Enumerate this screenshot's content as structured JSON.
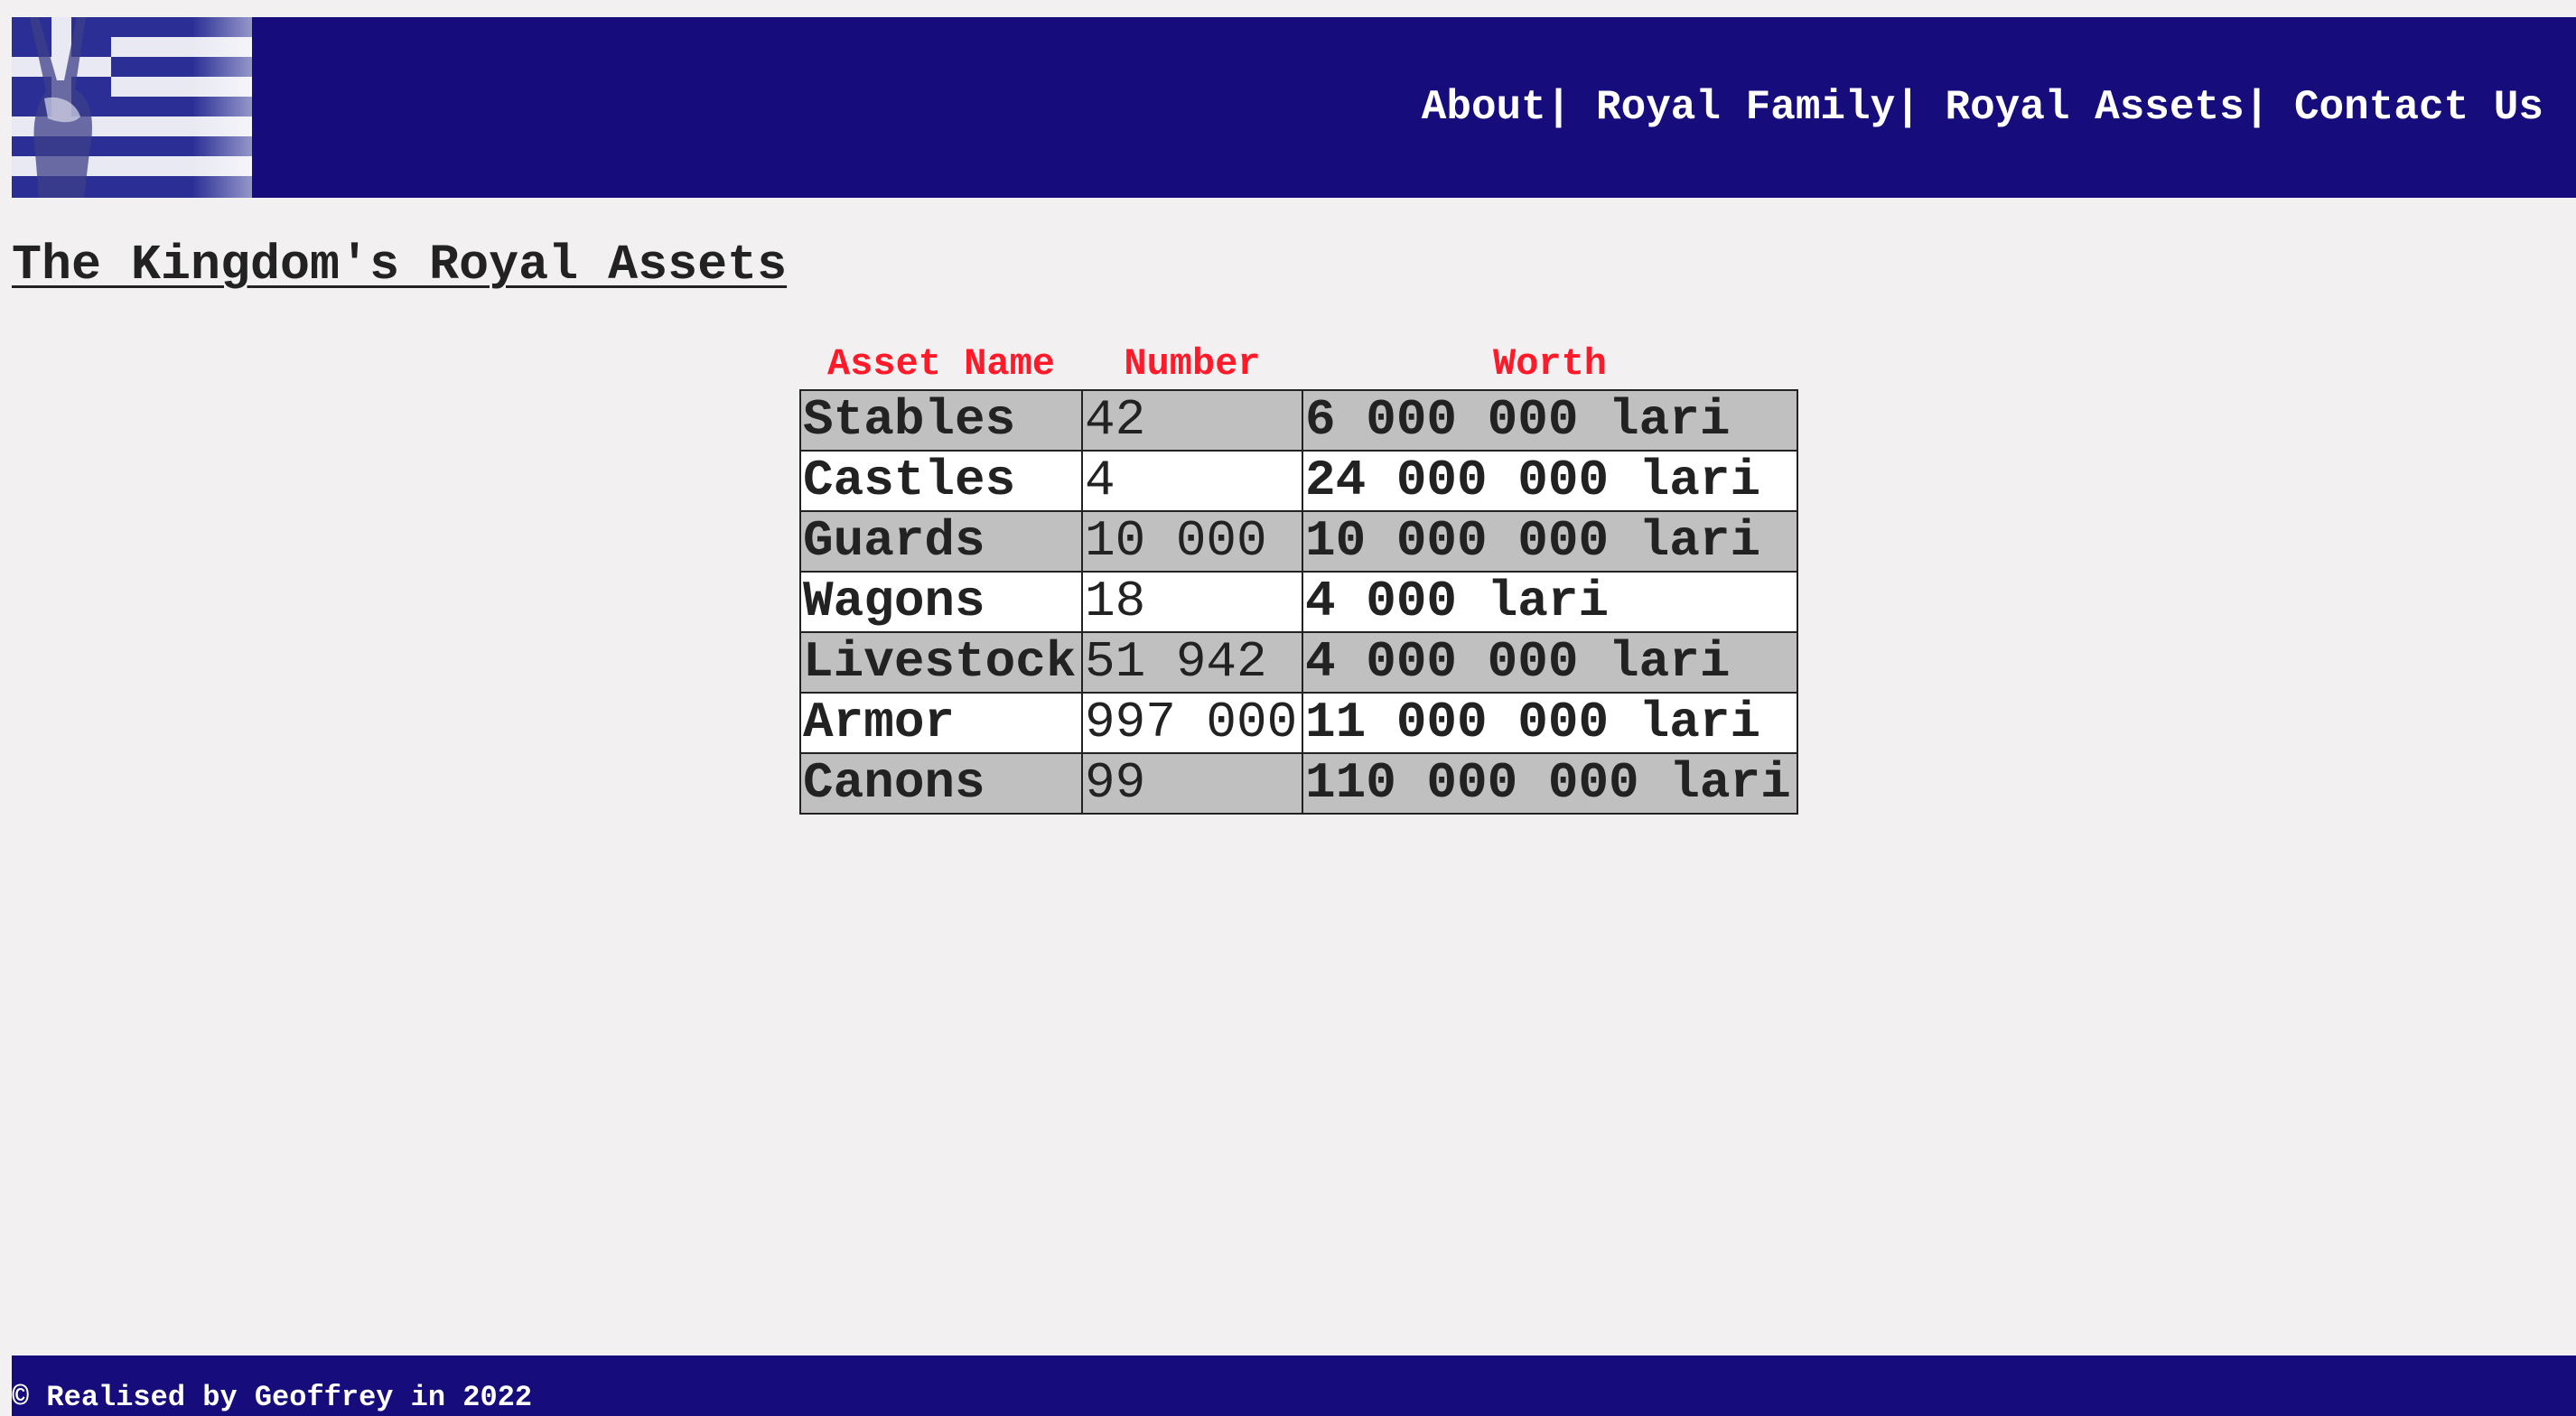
{
  "header": {
    "logo_icon": "greek-flag-peace-hand-icon",
    "nav": {
      "about": "About",
      "royal_family": "Royal Family",
      "royal_assets": "Royal Assets",
      "contact_us": "Contact Us",
      "separator": "| "
    }
  },
  "main": {
    "title": "The Kingdom's Royal Assets",
    "table": {
      "headers": [
        "Asset Name",
        "Number",
        "Worth"
      ],
      "rows": [
        {
          "name": "Stables",
          "number": "42",
          "worth": "6 000 000 lari"
        },
        {
          "name": "Castles",
          "number": "4",
          "worth": "24 000 000 lari"
        },
        {
          "name": "Guards",
          "number": "10 000",
          "worth": "10 000 000 lari"
        },
        {
          "name": "Wagons",
          "number": "18",
          "worth": "4 000 lari"
        },
        {
          "name": "Livestock",
          "number": "51 942",
          "worth": "4 000 000 lari"
        },
        {
          "name": "Armor",
          "number": "997 000",
          "worth": "11 000 000 lari"
        },
        {
          "name": "Canons",
          "number": "99",
          "worth": "110 000 000 lari"
        }
      ]
    }
  },
  "footer": {
    "text": "© Realised by Geoffrey in 2022"
  },
  "colors": {
    "header_bg": "#160c7b",
    "page_bg": "#f2f0f1",
    "table_header_text": "#ff1a2a",
    "row_odd_bg": "#c0c0c0",
    "row_even_bg": "#ffffff"
  }
}
